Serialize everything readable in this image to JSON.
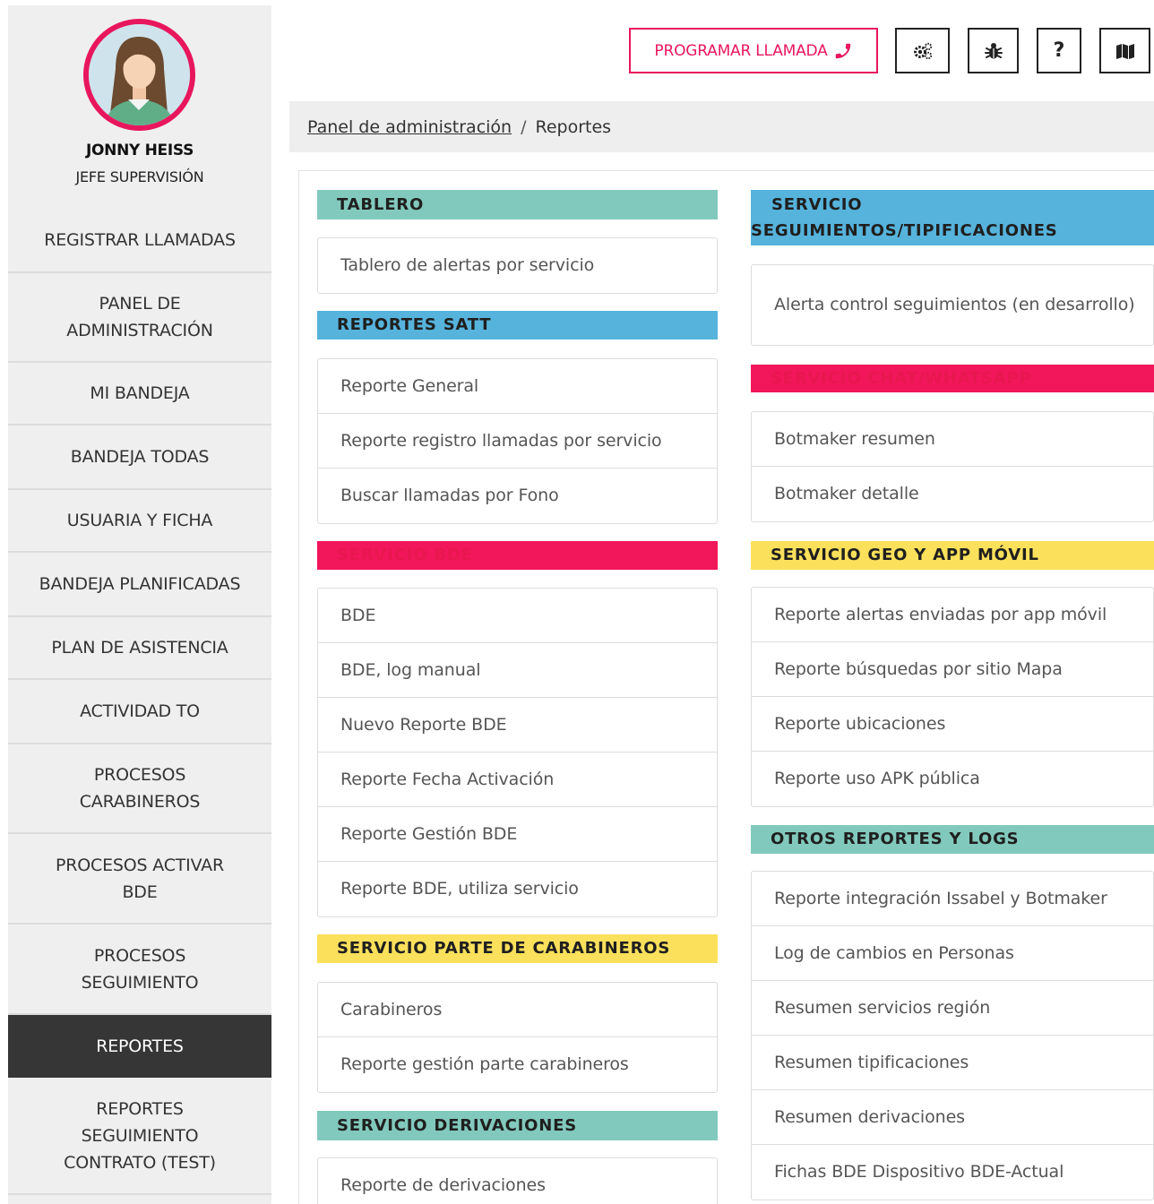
{
  "user": {
    "name": "JONNY HEISS",
    "role": "JEFE SUPERVISIÓN"
  },
  "nav": [
    "REGISTRAR LLAMADAS",
    "PANEL DE ADMINISTRACIÓN",
    "MI BANDEJA",
    "BANDEJA TODAS",
    "USUARIA Y FICHA",
    "BANDEJA PLANIFICADAS",
    "PLAN DE ASISTENCIA",
    "ACTIVIDAD TO",
    "PROCESOS CARABINEROS",
    "PROCESOS ACTIVAR BDE",
    "PROCESOS SEGUIMIENTO",
    "REPORTES",
    "REPORTES SEGUIMIENTO CONTRATO (TEST)"
  ],
  "active_nav": "REPORTES",
  "toolbar": {
    "program_call_label": "PROGRAMAR LLAMADA",
    "help_label": "?",
    "icons": [
      "phone-icon",
      "gears-icon",
      "bug-icon",
      "help-icon",
      "map-icon"
    ]
  },
  "breadcrumb": {
    "parent": "Panel de administración",
    "separator": "/",
    "current": "Reportes"
  },
  "colors": {
    "accent": "#e8175d",
    "teal": "#82c9bd",
    "blue": "#56b3dc",
    "pink": "#f2165b",
    "yellow": "#fbe05c",
    "active_nav": "#363636"
  },
  "sections": {
    "tablero": {
      "title": "TABLERO",
      "items": [
        "Tablero de alertas por servicio"
      ]
    },
    "satt": {
      "title": "REPORTES SATT",
      "items": [
        "Reporte General",
        "Reporte registro llamadas por servicio",
        "Buscar llamadas por Fono"
      ]
    },
    "bde": {
      "title": "SERVICIO BDE",
      "items": [
        "BDE",
        "BDE, log manual",
        "Nuevo Reporte BDE",
        "Reporte Fecha Activación",
        "Reporte Gestión BDE",
        "Reporte BDE, utiliza servicio"
      ]
    },
    "carabineros": {
      "title": "SERVICIO PARTE DE CARABINEROS",
      "items": [
        "Carabineros",
        "Reporte gestión parte carabineros"
      ]
    },
    "derivaciones": {
      "title": "SERVICIO DERIVACIONES",
      "items": [
        "Reporte de derivaciones"
      ]
    },
    "seguimientos": {
      "title_line1": "SERVICIO",
      "title_line2": "SEGUIMIENTOS/TIPIFICACIONES",
      "items": [
        "Alerta control seguimientos (en desarrollo)"
      ]
    },
    "chat": {
      "title": "SERVICIO CHAT/WHATSAPP",
      "items": [
        "Botmaker resumen",
        "Botmaker detalle"
      ]
    },
    "geo": {
      "title": "SERVICIO GEO Y APP MÓVIL",
      "items": [
        "Reporte alertas enviadas por app móvil",
        "Reporte búsquedas por sitio Mapa",
        "Reporte ubicaciones",
        "Reporte uso APK pública"
      ]
    },
    "otros": {
      "title": "OTROS REPORTES Y LOGS",
      "items": [
        "Reporte integración Issabel y Botmaker",
        "Log de cambios en Personas",
        "Resumen servicios región",
        "Resumen tipificaciones",
        "Resumen derivaciones",
        "Fichas BDE Dispositivo BDE-Actual"
      ]
    }
  }
}
